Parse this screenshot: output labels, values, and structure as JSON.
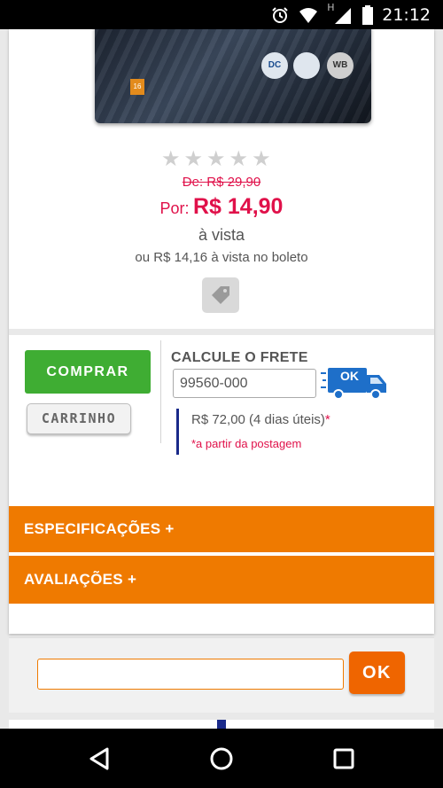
{
  "status_bar": {
    "time": "21:12",
    "network_label": "H",
    "icons": [
      "alarm-icon",
      "wifi-icon",
      "signal-icon",
      "battery-icon"
    ]
  },
  "product": {
    "rating_stars": 0,
    "rating_max": 5,
    "old_price": "De: R$ 29,90",
    "price_prefix": "Por:",
    "price": "R$ 14,90",
    "payment_note": "à vista",
    "boleto_note": "ou R$ 14,16 à vista no boleto",
    "age_rating": "16",
    "cover_logos": [
      "DC",
      "",
      "WB"
    ]
  },
  "actions": {
    "buy_label": "COMPRAR",
    "cart_label": "CARRINHO"
  },
  "shipping": {
    "title": "CALCULE O FRETE",
    "cep_value": "99560-000",
    "ok_label": "OK",
    "result": "R$ 72,00 (4 dias úteis)",
    "result_asterisk": "*",
    "footnote": "*a partir da postagem"
  },
  "accordion": {
    "specs_label": "ESPECIFICAÇÕES  +",
    "reviews_label": "AVALIAÇÕES  +"
  },
  "search": {
    "value": "",
    "ok_label": "OK"
  },
  "colors": {
    "price_red": "#e0114a",
    "buy_green": "#3fad33",
    "accent_orange": "#ef7a00",
    "shipping_bar_blue": "#1a2a8a"
  }
}
